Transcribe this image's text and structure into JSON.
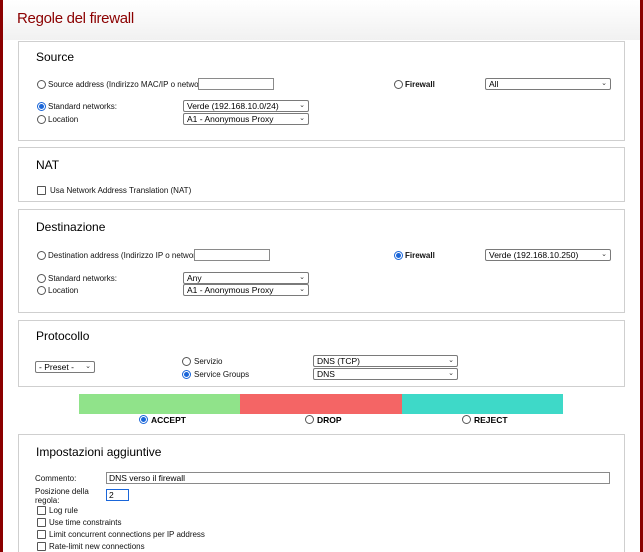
{
  "header": {
    "title": "Regole del firewall"
  },
  "source": {
    "title": "Source",
    "address_label": "Source address (Indirizzo MAC/IP o network):",
    "address_value": "",
    "firewall_label": "Firewall",
    "firewall_select": "All",
    "std_networks_label": "Standard networks:",
    "std_networks_select": "Verde (192.168.10.0/24)",
    "location_label": "Location",
    "location_select": "A1 - Anonymous Proxy"
  },
  "nat": {
    "title": "NAT",
    "nat_label": "Usa Network Address Translation (NAT)"
  },
  "destination": {
    "title": "Destinazione",
    "address_label": "Destination address (Indirizzo IP o network):",
    "address_value": "",
    "firewall_label": "Firewall",
    "firewall_select": "Verde (192.168.10.250)",
    "std_networks_label": "Standard networks:",
    "std_networks_select": "Any",
    "location_label": "Location",
    "location_select": "A1 - Anonymous Proxy"
  },
  "protocol": {
    "title": "Protocollo",
    "preset_select": "- Preset -",
    "service_label": "Servizio",
    "service_select": "DNS (TCP)",
    "groups_label": "Service Groups",
    "groups_select": "DNS"
  },
  "actions": {
    "accept": "ACCEPT",
    "drop": "DROP",
    "reject": "REJECT",
    "colors": {
      "accept": "#90e38a",
      "drop": "#f46565",
      "reject": "#3ed9c8"
    }
  },
  "settings": {
    "title": "Impostazioni aggiuntive",
    "comment_label": "Commento:",
    "comment_value": "DNS verso il firewall",
    "position_label_1": "Posizione della",
    "position_label_2": "regola:",
    "position_value": "2",
    "log_rule": "Log rule",
    "time_constraints": "Use time constraints",
    "limit_conn": "Limit concurrent connections per IP address",
    "rate_limit": "Rate-limit new connections"
  }
}
